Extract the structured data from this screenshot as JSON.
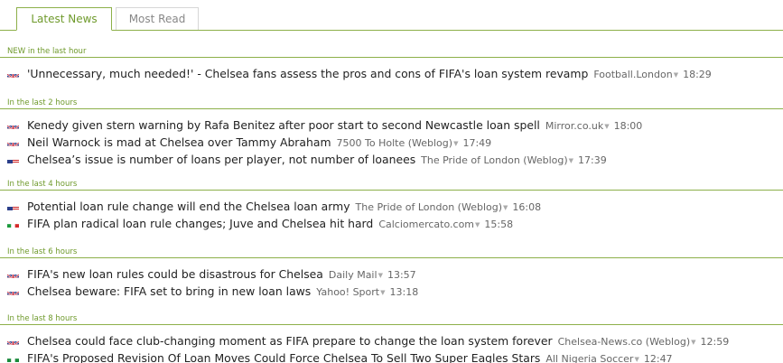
{
  "tabs": [
    {
      "label": "Latest News",
      "active": true
    },
    {
      "label": "Most Read",
      "active": false
    }
  ],
  "colors": {
    "accent": "#8db04a",
    "accent_text": "#6f9a2c"
  },
  "sections": [
    {
      "label": "NEW in the last hour",
      "items": [
        {
          "flag": "uk-flag-icon",
          "headline": "'Unnecessary, much needed!' - Chelsea fans assess the pros and cons of FIFA's loan system revamp",
          "source": "Football.London",
          "time": "18:29"
        }
      ]
    },
    {
      "label": "In the last 2 hours",
      "items": [
        {
          "flag": "uk-flag-icon",
          "headline": "Kenedy given stern warning by Rafa Benitez after poor start to second Newcastle loan spell",
          "source": "Mirror.co.uk",
          "time": "18:00"
        },
        {
          "flag": "uk-flag-icon",
          "headline": "Neil Warnock is mad at Chelsea over Tammy Abraham",
          "source": "7500 To Holte (Weblog)",
          "time": "17:49"
        },
        {
          "flag": "us-flag-icon",
          "headline": "Chelsea’s issue is number of loans per player, not number of loanees",
          "source": "The Pride of London (Weblog)",
          "time": "17:39"
        }
      ]
    },
    {
      "label": "In the last 4 hours",
      "items": [
        {
          "flag": "us-flag-icon",
          "headline": "Potential loan rule change will end the Chelsea loan army",
          "source": "The Pride of London (Weblog)",
          "time": "16:08"
        },
        {
          "flag": "it-flag-icon",
          "headline": "FIFA plan radical loan rule changes; Juve and Chelsea hit hard",
          "source": "Calciomercato.com",
          "time": "15:58"
        }
      ]
    },
    {
      "label": "In the last 6 hours",
      "items": [
        {
          "flag": "uk-flag-icon",
          "headline": "FIFA's new loan rules could be disastrous for Chelsea",
          "source": "Daily Mail",
          "time": "13:57"
        },
        {
          "flag": "uk-flag-icon",
          "headline": "Chelsea beware: FIFA set to bring in new loan laws",
          "source": "Yahoo! Sport",
          "time": "13:18"
        }
      ]
    },
    {
      "label": "In the last 8 hours",
      "items": [
        {
          "flag": "uk-flag-icon",
          "headline": "Chelsea could face club-changing moment as FIFA prepare to change the loan system forever",
          "source": "Chelsea-News.co (Weblog)",
          "time": "12:59"
        },
        {
          "flag": "ng-flag-icon",
          "headline": "FIFA's Proposed Revision Of Loan Moves Could Force Chelsea To Sell Two Super Eagles Stars",
          "source": "All Nigeria Soccer",
          "time": "12:47"
        }
      ]
    }
  ]
}
